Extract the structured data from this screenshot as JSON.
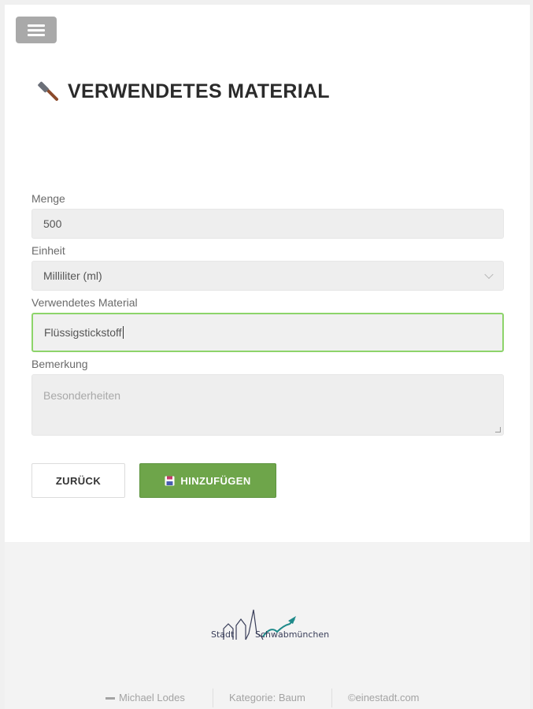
{
  "header": {
    "menu_icon": "hamburger-menu-icon",
    "title": "VERWENDETES MATERIAL",
    "title_icon": "hammer-icon"
  },
  "form": {
    "menge": {
      "label": "Menge",
      "value": "500"
    },
    "einheit": {
      "label": "Einheit",
      "value": "Milliliter (ml)"
    },
    "material": {
      "label": "Verwendetes Material",
      "value": "Flüssigstickstoff"
    },
    "bemerkung": {
      "label": "Bemerkung",
      "placeholder": "Besonderheiten"
    }
  },
  "buttons": {
    "back_label": "ZURÜCK",
    "add_label": "HINZUFÜGEN",
    "add_icon": "floppy-disk-icon"
  },
  "footer": {
    "logo_word1": "Stadt",
    "logo_word2": "Schwabmünchen",
    "author": "Michael Lodes",
    "category": "Kategorie: Baum",
    "copyright": "©einestadt.com"
  },
  "colors": {
    "accent_green": "#6ea54a",
    "focus_border": "#8dd46a",
    "logo_teal": "#1f8a8a",
    "logo_navy": "#3a3f5a"
  }
}
